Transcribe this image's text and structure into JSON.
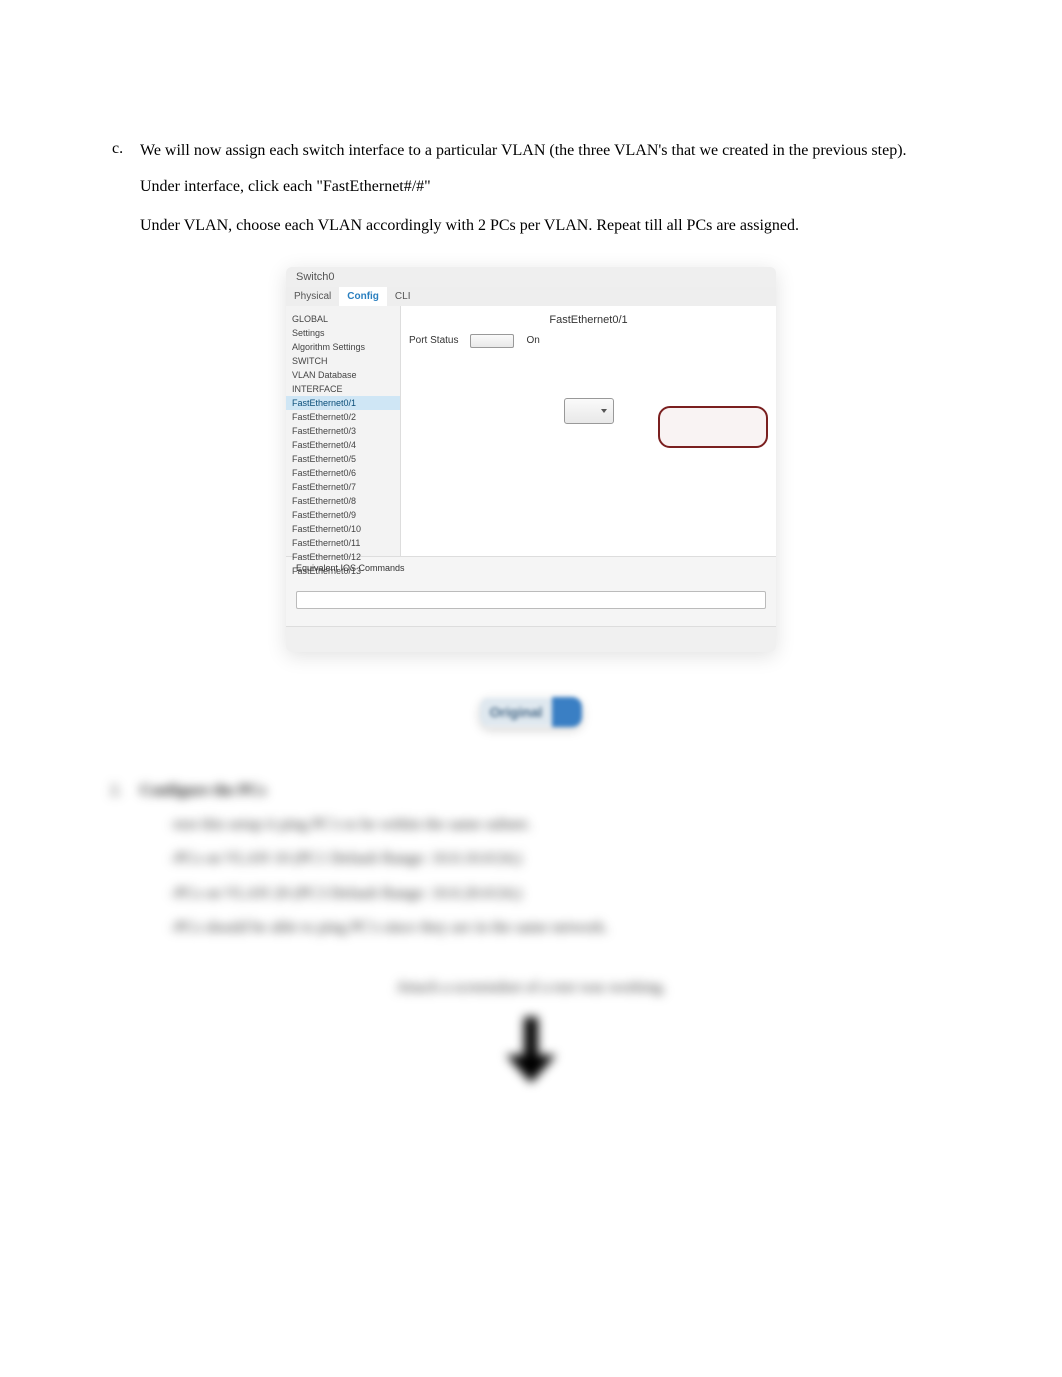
{
  "step": {
    "marker": "c.",
    "text": "We will now assign each switch interface to a particular VLAN (the three VLAN's that we created in the previous step)."
  },
  "para1": "Under interface, click each \"FastEthernet#/#\"",
  "para2": "Under VLAN, choose each VLAN accordingly with 2 PCs per VLAN. Repeat till all PCs are assigned.",
  "screenshot": {
    "windowTitle": "Switch0",
    "tabs": [
      "Physical",
      "Config",
      "CLI"
    ],
    "centerTitle": "FastEthernet0/1",
    "sideItems": [
      "GLOBAL",
      "Settings",
      "Algorithm Settings",
      "SWITCH",
      "VLAN Database",
      "INTERFACE",
      "FastEthernet0/1",
      "FastEthernet0/2",
      "FastEthernet0/3",
      "FastEthernet0/4",
      "FastEthernet0/5",
      "FastEthernet0/6",
      "FastEthernet0/7",
      "FastEthernet0/8",
      "FastEthernet0/9",
      "FastEthernet0/10",
      "FastEthernet0/11",
      "FastEthernet0/12",
      "FastEthernet0/13"
    ],
    "portStatusLabel": "Port Status",
    "onLabel": "On",
    "cliHeader": "Equivalent IOS Commands"
  },
  "pill": {
    "label": "Original"
  },
  "section2": {
    "marker": "2.",
    "title": "Configure the PCs",
    "line1": "-test this setup it ping PC's to be within the same subnet.",
    "line2": "-PCs on VLAN 10 (PC1   Default Range: 10.0.10.0/24;)",
    "line3": "-PCs on VLAN 20 (PC3   Default Range: 10.0.20.0/24;)",
    "line4": "-PCs should be able to ping PC's since they are in the same network."
  },
  "attachText": "Attach a screenshot of a test was working.",
  "chart_data": null
}
